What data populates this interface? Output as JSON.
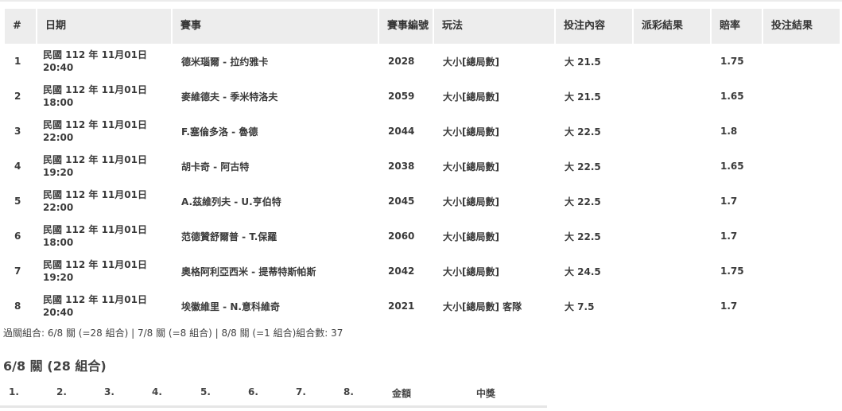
{
  "table": {
    "headers": [
      "#",
      "日期",
      "賽事",
      "賽事編號",
      "玩法",
      "投注內容",
      "派彩結果",
      "賠率",
      "投注結果"
    ],
    "rows": [
      {
        "no": "1",
        "date": "民國 112 年 11月01日",
        "time": "20:40",
        "match": "德米瑙爾 - 拉约雅卡",
        "code": "2028",
        "play": "大小[總局數]",
        "bet": "大 21.5",
        "payout": "",
        "odds": "1.75",
        "result": ""
      },
      {
        "no": "2",
        "date": "民國 112 年 11月01日",
        "time": "18:00",
        "match": "麥維德夫 - 季米特洛夫",
        "code": "2059",
        "play": "大小[總局數]",
        "bet": "大 21.5",
        "payout": "",
        "odds": "1.65",
        "result": ""
      },
      {
        "no": "3",
        "date": "民國 112 年 11月01日",
        "time": "22:00",
        "match": "F.塞倫多洛 - 魯德",
        "code": "2044",
        "play": "大小[總局數]",
        "bet": "大 22.5",
        "payout": "",
        "odds": "1.8",
        "result": ""
      },
      {
        "no": "4",
        "date": "民國 112 年 11月01日",
        "time": "19:20",
        "match": "胡卡奇 - 阿古特",
        "code": "2038",
        "play": "大小[總局數]",
        "bet": "大 22.5",
        "payout": "",
        "odds": "1.65",
        "result": ""
      },
      {
        "no": "5",
        "date": "民國 112 年 11月01日",
        "time": "22:00",
        "match": "A.茲維列夫 - U.亨伯特",
        "code": "2045",
        "play": "大小[總局數]",
        "bet": "大 22.5",
        "payout": "",
        "odds": "1.7",
        "result": ""
      },
      {
        "no": "6",
        "date": "民國 112 年 11月01日",
        "time": "18:00",
        "match": "范德贊舒爾普 - T.保羅",
        "code": "2060",
        "play": "大小[總局數]",
        "bet": "大 22.5",
        "payout": "",
        "odds": "1.7",
        "result": ""
      },
      {
        "no": "7",
        "date": "民國 112 年 11月01日",
        "time": "19:20",
        "match": "奧格阿利亞西米 - 提蒂特斯帕斯",
        "code": "2042",
        "play": "大小[總局數]",
        "bet": "大 24.5",
        "payout": "",
        "odds": "1.75",
        "result": ""
      },
      {
        "no": "8",
        "date": "民國 112 年 11月01日",
        "time": "20:40",
        "match": "埃徽維里 - N.意科維奇",
        "code": "2021",
        "play": "大小[總局數] 客隊",
        "bet": "大 7.5",
        "payout": "",
        "odds": "1.7",
        "result": ""
      }
    ]
  },
  "summary": "過關組合: 6/8 關 (=28 組合) | 7/8 關 (=8 組合) | 8/8 關 (=1 組合)組合數: 37",
  "section_title": "6/8 關 (28 組合)",
  "combo_headers": [
    "1.",
    "2.",
    "3.",
    "4.",
    "5.",
    "6.",
    "7.",
    "8.",
    "金額",
    "中獎"
  ]
}
